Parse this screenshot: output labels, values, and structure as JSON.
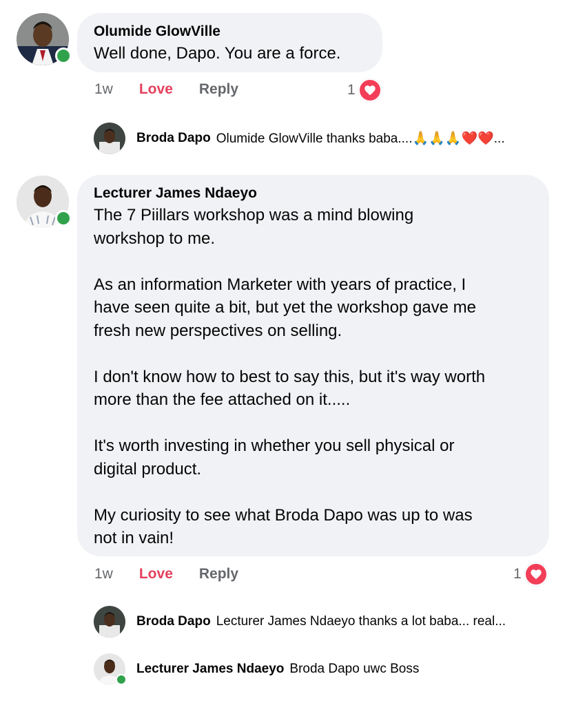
{
  "comments": [
    {
      "author": "Olumide GlowVille",
      "text": "Well done, Dapo. You are a force.",
      "time": "1w",
      "love_label": "Love",
      "reply_label": "Reply",
      "reaction_count": "1",
      "reply": {
        "author": "Broda Dapo",
        "text": "Olumide GlowVille thanks baba....🙏🙏🙏❤️❤️..."
      }
    },
    {
      "author": "Lecturer James Ndaeyo",
      "text": "The 7 Piillars workshop was a mind blowing\nworkshop to me.\n\nAs an information Marketer with years of practice, I\nhave seen quite a bit, but yet the workshop gave me\nfresh new perspectives on selling.\n\nI don't know how to best to say this, but it's way worth\nmore than the fee attached on it.....\n\nIt's worth investing in whether you sell physical or\ndigital product.\n\nMy curiosity to see what Broda Dapo was up to was\nnot in vain!",
      "time": "1w",
      "love_label": "Love",
      "reply_label": "Reply",
      "reaction_count": "1",
      "replies": [
        {
          "author": "Broda Dapo",
          "text": "Lecturer James Ndaeyo thanks a lot baba... real..."
        },
        {
          "author": "Lecturer James Ndaeyo",
          "text": "Broda Dapo uwc Boss"
        }
      ]
    }
  ],
  "colors": {
    "bubble": "#f0f2f5",
    "love": "#e4415d",
    "meta": "#65676b",
    "online": "#31a24c",
    "heart": "#f33e58"
  },
  "icons": [
    "heart-reaction-icon",
    "online-status-icon"
  ]
}
